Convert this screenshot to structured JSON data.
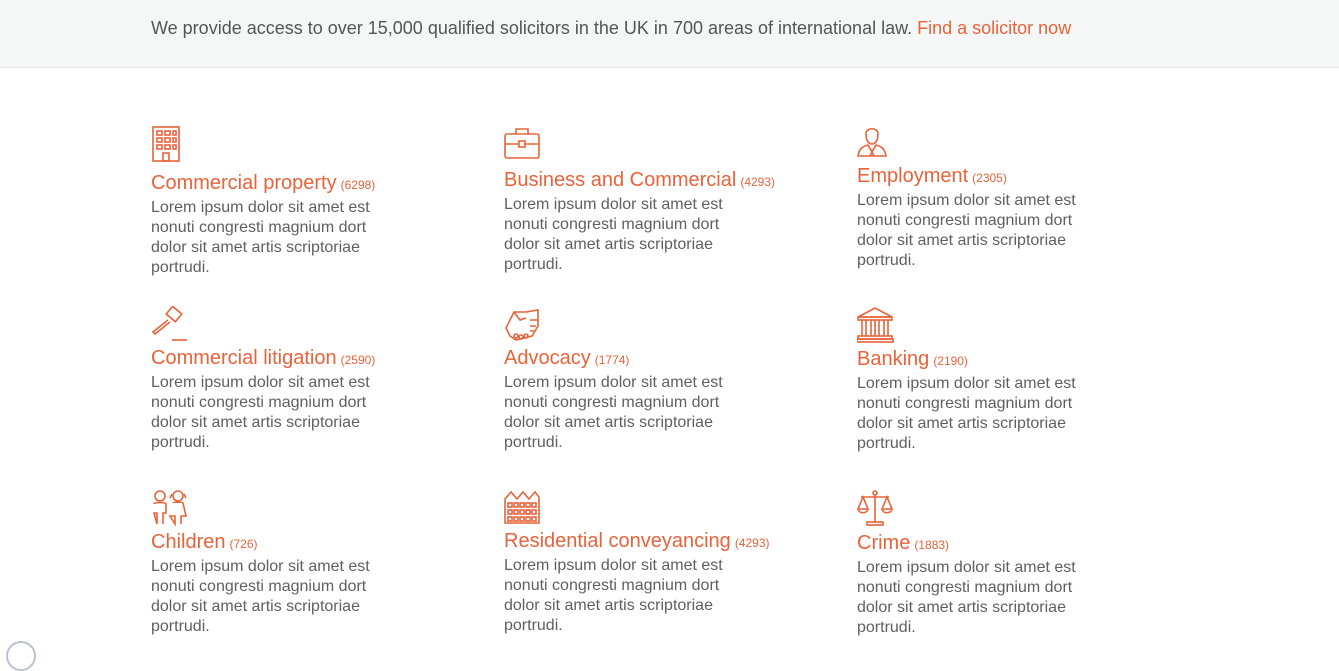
{
  "banner": {
    "text": "We provide access to over 15,000 qualified solicitors in the UK in 700 areas of international law.",
    "link": "Find a solicitor now"
  },
  "colors": {
    "accent": "#e8633a",
    "text": "#5f5f5f",
    "banner_bg": "#f5f6f6"
  },
  "areas": [
    {
      "title": "Commercial property",
      "count": "(6298)",
      "icon": "building-icon",
      "desc": "Lorem ipsum dolor sit amet est nonuti congresti magnium dort dolor sit amet artis scriptoriae portrudi."
    },
    {
      "title": "Business and Commercial",
      "count": "(4293)",
      "icon": "briefcase-icon",
      "desc": "Lorem ipsum dolor sit amet est nonuti congresti magnium dort dolor sit amet artis scriptoriae portrudi."
    },
    {
      "title": "Employment",
      "count": "(2305)",
      "icon": "person-icon",
      "desc": "Lorem ipsum dolor sit amet est nonuti congresti magnium dort dolor sit amet artis scriptoriae portrudi."
    },
    {
      "title": "Commercial litigation",
      "count": "(2590)",
      "icon": "gavel-icon",
      "desc": "Lorem ipsum dolor sit amet est nonuti congresti magnium dort dolor sit amet artis scriptoriae portrudi."
    },
    {
      "title": "Advocacy",
      "count": "(1774)",
      "icon": "handshake-icon",
      "desc": "Lorem ipsum dolor sit amet est nonuti congresti magnium dort dolor sit amet artis scriptoriae portrudi."
    },
    {
      "title": "Banking",
      "count": "(2190)",
      "icon": "bank-icon",
      "desc": "Lorem ipsum dolor sit amet est nonuti congresti magnium dort dolor sit amet artis scriptoriae portrudi."
    },
    {
      "title": "Children",
      "count": "(726)",
      "icon": "children-icon",
      "desc": "Lorem ipsum dolor sit amet est nonuti congresti magnium dort dolor sit amet artis scriptoriae portrudi."
    },
    {
      "title": "Residential conveyancing",
      "count": "(4293)",
      "icon": "houses-icon",
      "desc": "Lorem ipsum dolor sit amet est nonuti congresti magnium dort dolor sit amet artis scriptoriae portrudi."
    },
    {
      "title": "Crime",
      "count": "(1883)",
      "icon": "scales-icon",
      "desc": "Lorem ipsum dolor sit amet est nonuti congresti magnium dort dolor sit amet artis scriptoriae portrudi."
    }
  ]
}
